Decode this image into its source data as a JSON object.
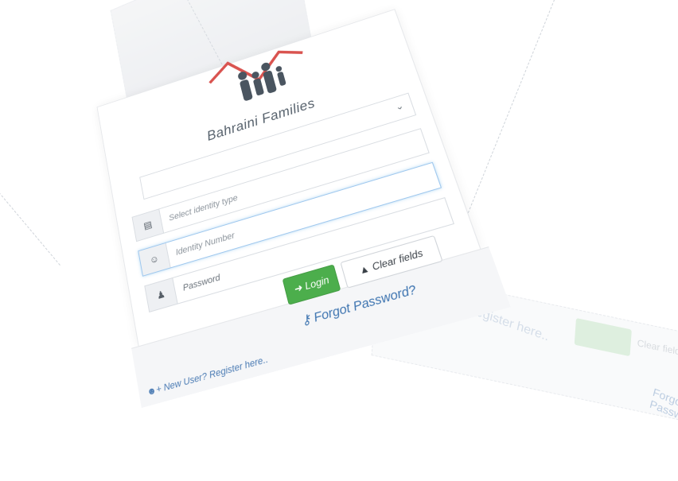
{
  "brand": {
    "title": "Bahraini Families",
    "logo_icon": "family-logo-icon"
  },
  "form": {
    "identity_type_select": {
      "icon": "chevron-down-icon"
    },
    "identity_type_field": {
      "placeholder": "Select identity type",
      "icon": "id-card-icon"
    },
    "identity_number_field": {
      "placeholder": "Identity Number",
      "icon": "user-icon"
    },
    "password_field": {
      "placeholder": "Password",
      "icon": "user-lock-icon"
    }
  },
  "buttons": {
    "login_label": "Login",
    "login_icon": "sign-in-icon",
    "clear_label": "Clear fields",
    "clear_icon": "eraser-icon"
  },
  "links": {
    "forgot_password": "Forgot Password?",
    "forgot_icon": "key-icon",
    "register": "New User? Register here..",
    "register_icon": "user-plus-icon"
  },
  "colors": {
    "login_green": "#4cae4c",
    "link_blue": "#3d74b0",
    "logo_red": "#d9534f",
    "logo_gray": "#4a5560"
  }
}
